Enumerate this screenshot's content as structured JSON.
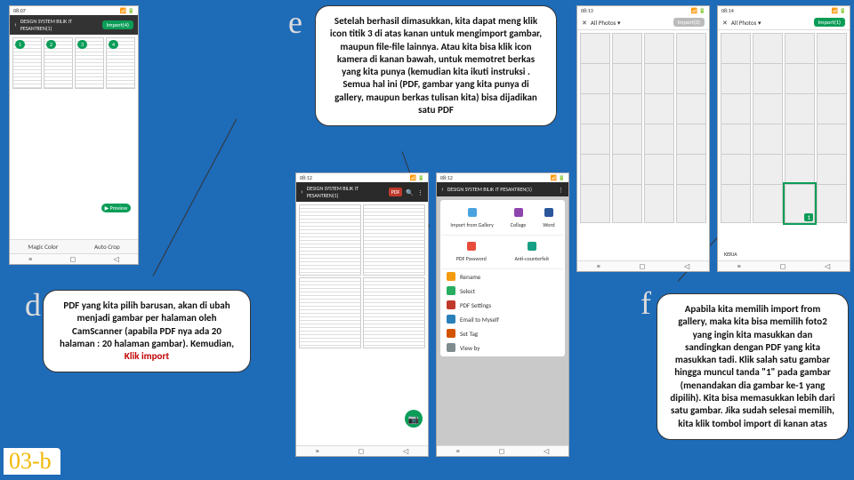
{
  "slide_number": "03-b",
  "letters": {
    "d": "d",
    "e": "e",
    "f": "f"
  },
  "callouts": {
    "e": "Setelah berhasil dimasukkan, kita dapat meng klik icon titik 3 di atas kanan untuk mengimport gambar, maupun file-file lainnya. Atau kita bisa klik icon kamera di kanan bawah, untuk memotret berkas yang kita punya (kemudian kita ikuti instruksi . Semua hal ini (PDF, gambar yang kita punya di gallery, maupun berkas tulisan kita) bisa dijadikan satu PDF",
    "d_part1": "PDF yang kita pilih barusan, akan di ubah menjadi gambar per halaman oleh CamScanner (apabila PDF nya ada 20 halaman : 20 halaman gambar). Kemudian, ",
    "d_red": "Klik import",
    "f": "Apabila kita memilih import from gallery, maka kita bisa memilih foto2 yang ingin kita masukkan dan sandingkan dengan PDF yang kita masukkan tadi. Klik salah satu gambar hingga muncul tanda \"1\" pada gambar (menandakan dia gambar ke-1 yang dipilih). Kita bisa memasukkan lebih dari satu gambar. Jika sudah selesai memilih, kita klik tombol import di kanan atas"
  },
  "phone_d": {
    "time": "08:07",
    "appbar_title": "DESIGN SYSTEM BILIK IT PESANTREN(1)",
    "import_label": "Import(4)",
    "magic_color": "Magic Color",
    "auto_crop": "Auto Crop",
    "page_badges": [
      "1",
      "2",
      "3",
      "4"
    ]
  },
  "phone_e1": {
    "time": "08:12",
    "appbar_title": "DESIGN SYSTEM BILIK IT PESANTREN(1)",
    "pdf_btn": "PDF"
  },
  "phone_e2": {
    "time": "08:12",
    "appbar_title": "DESIGN SYSTEM BILIK IT PESANTREN(1)",
    "menu": [
      "Import from Gallery",
      "Collage",
      "Word",
      "PDF Password",
      "Anti-counterfeit",
      "Rename",
      "Select",
      "PDF Settings",
      "Email to Myself",
      "Set Tag",
      "View by"
    ]
  },
  "phone_f1": {
    "time": "08:13",
    "close": "✕",
    "sel_count": "All Photos ▾",
    "import_label": "Import(0)"
  },
  "phone_f2": {
    "time": "08:14",
    "sel_count": "All Photos ▾",
    "import_label": "Import(1)",
    "tag": "1",
    "album": "KERJA"
  }
}
